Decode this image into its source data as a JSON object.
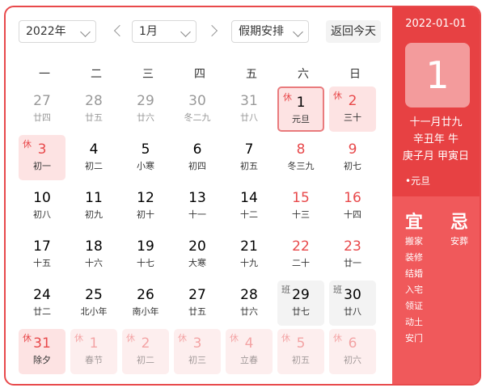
{
  "toolbar": {
    "year_select": "2022年",
    "month_select": "1月",
    "holiday_select": "假期安排",
    "today_button": "返回今天"
  },
  "weekdays": [
    "一",
    "二",
    "三",
    "四",
    "五",
    "六",
    "日"
  ],
  "days": [
    {
      "num": "27",
      "lunar": "廿四",
      "type": "other"
    },
    {
      "num": "28",
      "lunar": "廿五",
      "type": "other"
    },
    {
      "num": "29",
      "lunar": "廿六",
      "type": "other"
    },
    {
      "num": "30",
      "lunar": "冬二九",
      "type": "other"
    },
    {
      "num": "31",
      "lunar": "廿八",
      "type": "other"
    },
    {
      "num": "1",
      "lunar": "元旦",
      "type": "selected",
      "tag": "休"
    },
    {
      "num": "2",
      "lunar": "三十",
      "type": "holiday",
      "tag": "休"
    },
    {
      "num": "3",
      "lunar": "初一",
      "type": "holiday",
      "tag": "休"
    },
    {
      "num": "4",
      "lunar": "初二",
      "type": "normal"
    },
    {
      "num": "5",
      "lunar": "小寒",
      "type": "normal"
    },
    {
      "num": "6",
      "lunar": "初四",
      "type": "normal"
    },
    {
      "num": "7",
      "lunar": "初五",
      "type": "normal"
    },
    {
      "num": "8",
      "lunar": "冬三九",
      "type": "weekend"
    },
    {
      "num": "9",
      "lunar": "初七",
      "type": "weekend"
    },
    {
      "num": "10",
      "lunar": "初八",
      "type": "normal"
    },
    {
      "num": "11",
      "lunar": "初九",
      "type": "normal"
    },
    {
      "num": "12",
      "lunar": "初十",
      "type": "normal"
    },
    {
      "num": "13",
      "lunar": "十一",
      "type": "normal"
    },
    {
      "num": "14",
      "lunar": "十二",
      "type": "normal"
    },
    {
      "num": "15",
      "lunar": "十三",
      "type": "weekend"
    },
    {
      "num": "16",
      "lunar": "十四",
      "type": "weekend"
    },
    {
      "num": "17",
      "lunar": "十五",
      "type": "normal"
    },
    {
      "num": "18",
      "lunar": "十六",
      "type": "normal"
    },
    {
      "num": "19",
      "lunar": "十七",
      "type": "normal"
    },
    {
      "num": "20",
      "lunar": "大寒",
      "type": "normal"
    },
    {
      "num": "21",
      "lunar": "十九",
      "type": "normal"
    },
    {
      "num": "22",
      "lunar": "二十",
      "type": "weekend"
    },
    {
      "num": "23",
      "lunar": "廿一",
      "type": "weekend"
    },
    {
      "num": "24",
      "lunar": "廿二",
      "type": "normal"
    },
    {
      "num": "25",
      "lunar": "北小年",
      "type": "normal"
    },
    {
      "num": "26",
      "lunar": "南小年",
      "type": "normal"
    },
    {
      "num": "27",
      "lunar": "廿五",
      "type": "normal"
    },
    {
      "num": "28",
      "lunar": "廿六",
      "type": "normal"
    },
    {
      "num": "29",
      "lunar": "廿七",
      "type": "work",
      "tag": "班"
    },
    {
      "num": "30",
      "lunar": "廿八",
      "type": "work",
      "tag": "班"
    },
    {
      "num": "31",
      "lunar": "除夕",
      "type": "holiday",
      "tag": "休"
    },
    {
      "num": "1",
      "lunar": "春节",
      "type": "nextmonth holiday",
      "tag": "休"
    },
    {
      "num": "2",
      "lunar": "初二",
      "type": "nextmonth holiday",
      "tag": "休"
    },
    {
      "num": "3",
      "lunar": "初三",
      "type": "nextmonth holiday",
      "tag": "休"
    },
    {
      "num": "4",
      "lunar": "立春",
      "type": "nextmonth holiday",
      "tag": "休"
    },
    {
      "num": "5",
      "lunar": "初五",
      "type": "nextmonth holiday",
      "tag": "休"
    },
    {
      "num": "6",
      "lunar": "初六",
      "type": "nextmonth holiday",
      "tag": "休"
    }
  ],
  "panel": {
    "date": "2022-01-01",
    "big_day": "1",
    "lunar_date": "十一月廿九",
    "year_ganzhi": "辛丑年 牛",
    "month_day_ganzhi": "庚子月 甲寅日",
    "festival": "•元旦",
    "yi_title": "宜",
    "ji_title": "忌",
    "yi": [
      "搬家",
      "装修",
      "结婚",
      "入宅",
      "领证",
      "动土",
      "安门"
    ],
    "ji": [
      "安葬"
    ]
  },
  "colors": {
    "accent": "#e8494b",
    "holiday_bg": "#fde3e3",
    "work_bg": "#f3f3f3"
  }
}
